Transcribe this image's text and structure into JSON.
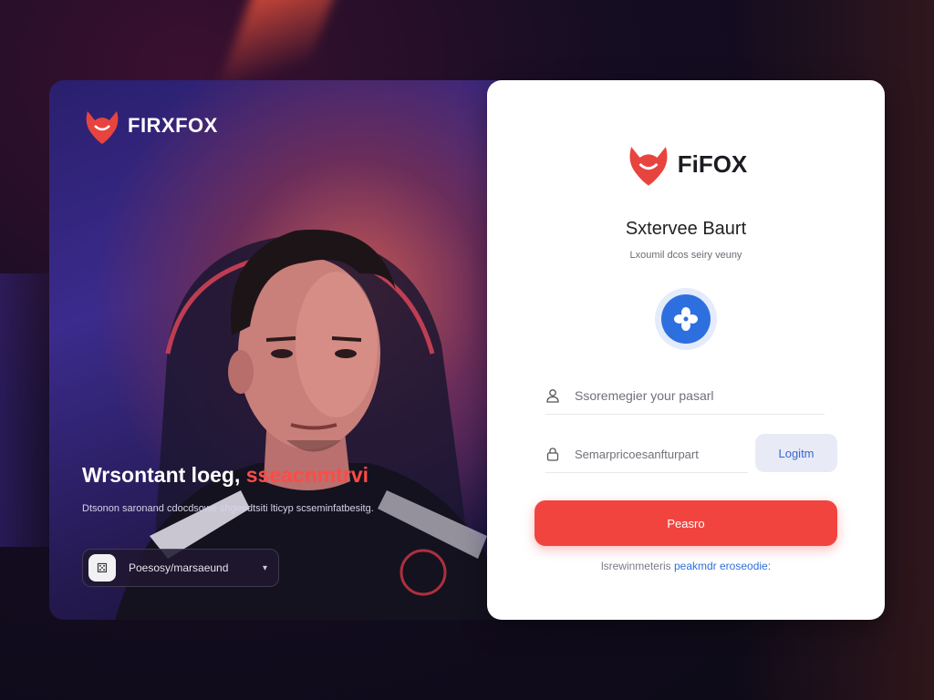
{
  "hero": {
    "brand": "FIRXFOX",
    "headline": "Wrsontant loeg,",
    "headline_accent": "sseacnmtrvi",
    "subtext": "Dtsonon saronand cdocdsowe shgeedtsiti lticyp scseminfatbesitg.",
    "selector_label": "Poesosy/marsaeund",
    "selector_icon": "dice-icon"
  },
  "login": {
    "brand": "FiFOX",
    "title": "Sxtervee Baurt",
    "subtitle": "Lxoumil dcos seiry veuny",
    "sso_icon": "clover-icon",
    "field1_placeholder": "Ssoremegier your pasarl",
    "field2_placeholder": "Semarpricoesanfturpart",
    "inline_button": "Logitm",
    "primary_button": "Peasro",
    "footer_text": "lsrewinmeteris",
    "footer_link": "peakmdr eroseodie:"
  },
  "colors": {
    "accent_red": "#f2443f",
    "link_blue": "#2f6fd9",
    "sso_blue": "#2e6fe0"
  }
}
